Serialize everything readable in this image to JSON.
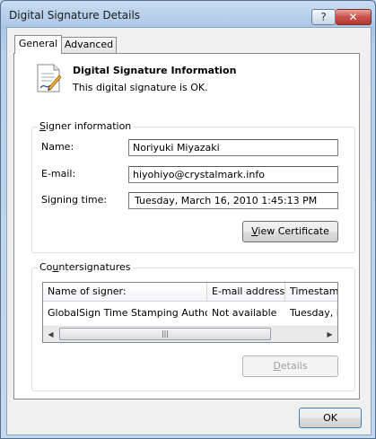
{
  "window": {
    "title": "Digital Signature Details",
    "help_glyph": "?",
    "close_glyph": "✕"
  },
  "tabs": [
    {
      "label": "General"
    },
    {
      "label": "Advanced"
    }
  ],
  "header": {
    "title": "Digital Signature Information",
    "status": "This digital signature is OK."
  },
  "signer": {
    "legend_pre": "",
    "legend_ul": "S",
    "legend_post": "igner information",
    "name_label": "Name:",
    "name_value": "Noriyuki Miyazaki",
    "email_label": "E-mail:",
    "email_value": "hiyohiyo@crystalmark.info",
    "time_label": "Signing time:",
    "time_value": "Tuesday,  March  16,  2010 1:45:13 PM",
    "view_cert_ul": "V",
    "view_cert_rest": "iew Certificate"
  },
  "countersignatures": {
    "legend_pre": "Co",
    "legend_ul": "u",
    "legend_post": "ntersignatures",
    "columns": [
      "Name of signer:",
      "E-mail address:",
      "Timestamp"
    ],
    "rows": [
      [
        "GlobalSign Time Stamping Authority",
        "Not available",
        "Tuesday, M"
      ]
    ],
    "scroll_left": "◀",
    "scroll_right": "▶",
    "thumb_grip": "|||",
    "details_ul": "D",
    "details_rest": "etails"
  },
  "ok_label": "OK"
}
